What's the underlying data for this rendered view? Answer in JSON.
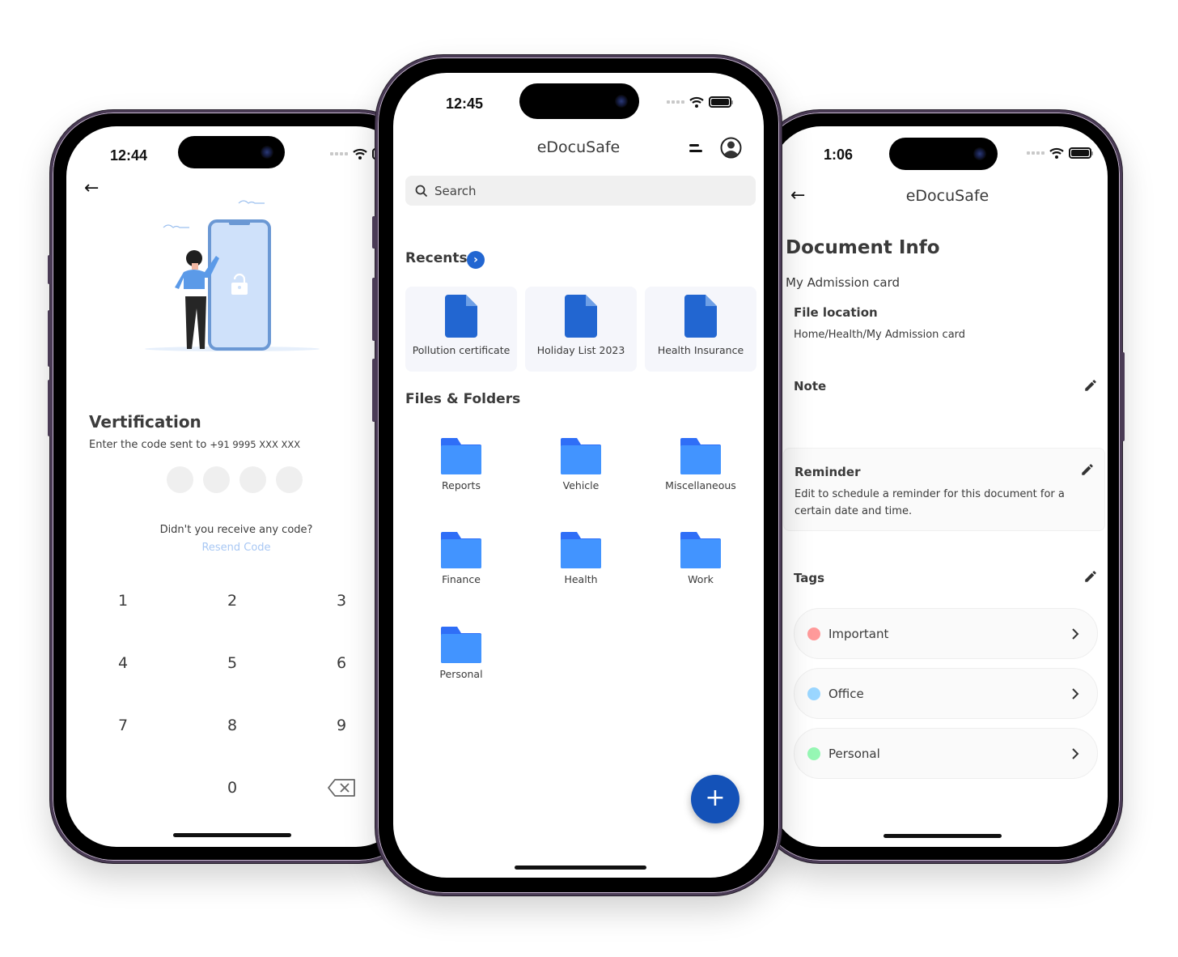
{
  "left_phone": {
    "status": {
      "time": "12:44"
    },
    "title": "Vertification",
    "subtitle_prefix": "Enter the code sent to ",
    "phone_number": "+91 9995 XXX XXX",
    "otp_length": 4,
    "resend_question": "Didn't you receive any code?",
    "resend_link": "Resend Code",
    "keypad": [
      "1",
      "2",
      "3",
      "4",
      "5",
      "6",
      "7",
      "8",
      "9",
      "0"
    ],
    "colors": {
      "link": "#a9c8f4",
      "otp_dot": "#efefef"
    }
  },
  "center_phone": {
    "status": {
      "time": "12:45"
    },
    "app_title": "eDocuSafe",
    "search": {
      "placeholder": "Search"
    },
    "recents": {
      "title": "Recents",
      "items": [
        {
          "label": "Pollution certificate"
        },
        {
          "label": "Holiday List 2023"
        },
        {
          "label": "Health Insurance"
        }
      ]
    },
    "files": {
      "title": "Files & Folders",
      "folders": [
        {
          "label": "Reports"
        },
        {
          "label": "Vehicle"
        },
        {
          "label": "Miscellaneous"
        },
        {
          "label": "Finance"
        },
        {
          "label": "Health"
        },
        {
          "label": "Work"
        },
        {
          "label": "Personal"
        }
      ]
    },
    "fab_label": "+",
    "colors": {
      "accent": "#2266d1",
      "fab": "#1452b8",
      "folder": "#4294ff",
      "folder_tab": "#2f6ef7"
    }
  },
  "right_phone": {
    "status": {
      "time": "1:06"
    },
    "app_title": "eDocuSafe",
    "title": "Document Info",
    "document_name": "My Admission card",
    "file_location_label": "File location",
    "file_location": "Home/Health/My Admission card",
    "note_label": "Note",
    "reminder_label": "Reminder",
    "reminder_desc": "Edit to schedule a reminder for this document for a certain date and time.",
    "tags_label": "Tags",
    "tags": [
      {
        "label": "Important",
        "color": "#ff9a9a"
      },
      {
        "label": "Office",
        "color": "#9ad6ff"
      },
      {
        "label": "Personal",
        "color": "#96f7b4"
      }
    ]
  }
}
